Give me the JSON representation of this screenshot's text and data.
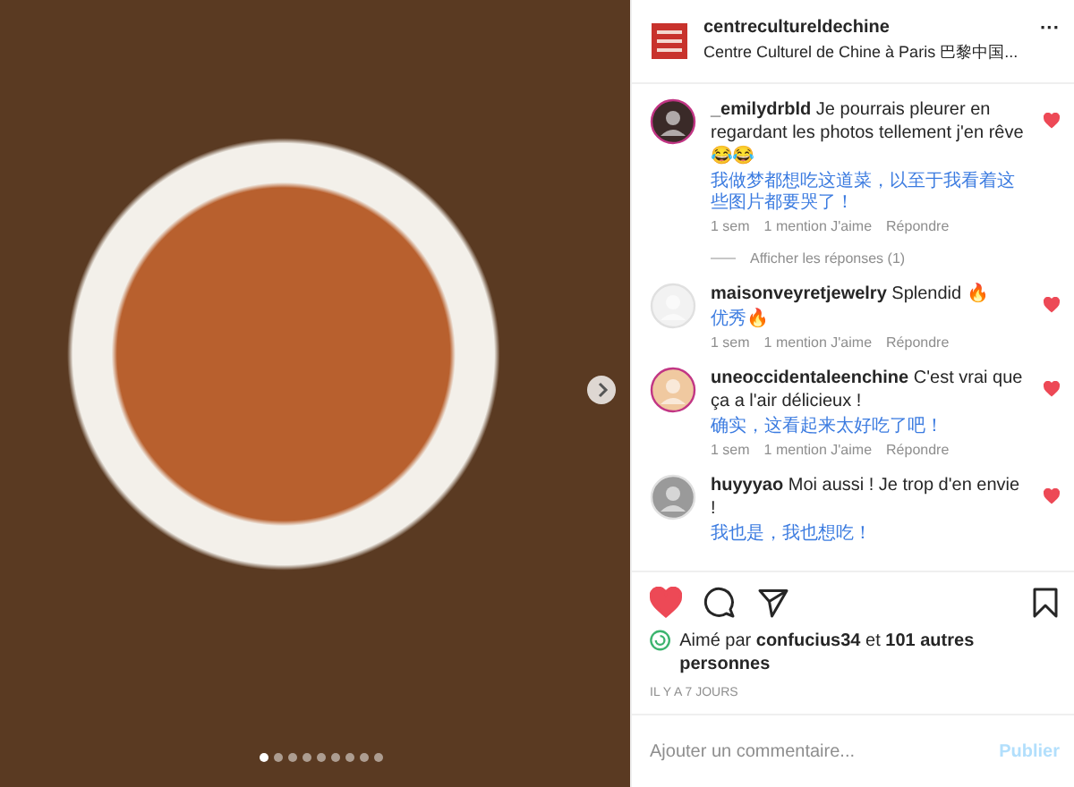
{
  "photo": {
    "dots": [
      {
        "selected": true
      },
      {
        "selected": false
      },
      {
        "selected": false
      },
      {
        "selected": false
      },
      {
        "selected": false
      },
      {
        "selected": false
      },
      {
        "selected": false
      },
      {
        "selected": false
      },
      {
        "selected": false
      }
    ]
  },
  "header": {
    "username": "centrecultureldechine",
    "subtitle": "Centre Culturel de Chine à Paris 巴黎中国...",
    "more": "···"
  },
  "comments": [
    {
      "username": "_emilydrbld",
      "text": "Je pourrais pleurer en regardant les photos tellement j'en rêve 😂😂",
      "translation": "我做梦都想吃这道菜，以至于我看着这些图片都要哭了！",
      "time": "1 sem",
      "likes": "1 mention J'aime",
      "reply": "Répondre",
      "liked": true,
      "replies": "Afficher les réponses (1)"
    },
    {
      "username": "maisonveyretjewelry",
      "text": "Splendid 🔥",
      "translation": "优秀🔥",
      "time": "1 sem",
      "likes": "1 mention J'aime",
      "reply": "Répondre",
      "liked": true
    },
    {
      "username": "uneoccidentaleenchine",
      "text": "C'est vrai que ça a l'air délicieux !",
      "translation": "确实，这看起来太好吃了吧！",
      "time": "1 sem",
      "likes": "1 mention J'aime",
      "reply": "Répondre",
      "liked": true
    },
    {
      "username": "huyyyao",
      "text": "Moi aussi ! Je trop d'en envie !",
      "translation": "我也是，我也想吃！",
      "liked": true
    }
  ],
  "actions": {
    "liked": true,
    "saved": false
  },
  "liked_by": {
    "prefix": "Aimé par",
    "user": "confucius34",
    "middle": "et",
    "others": "101 autres personnes"
  },
  "posted": "IL Y A 7 JOURS",
  "comment_field": {
    "placeholder": "Ajouter un commentaire...",
    "publish": "Publier"
  }
}
